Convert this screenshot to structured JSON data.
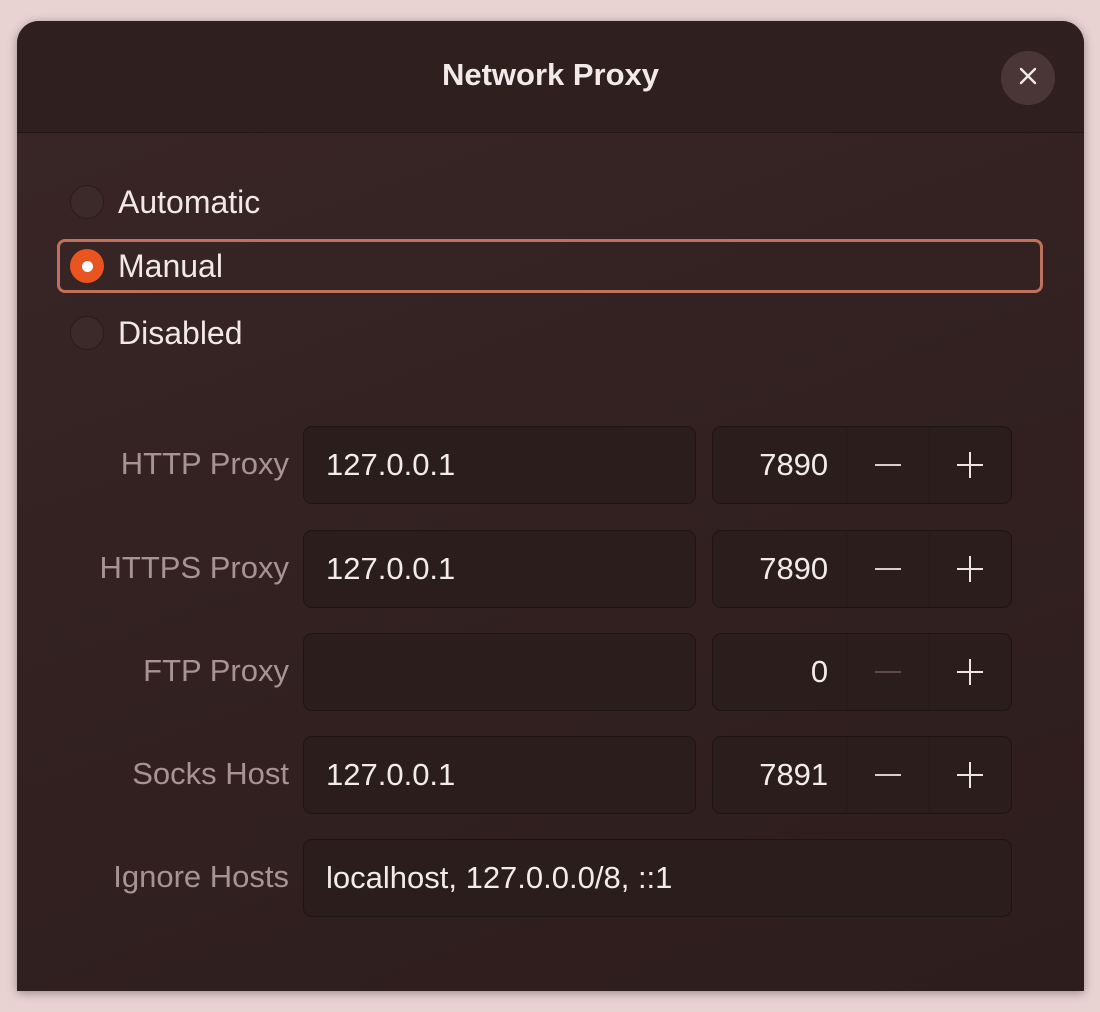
{
  "window": {
    "title": "Network Proxy",
    "close_icon": "close-icon"
  },
  "modes": [
    {
      "label": "Automatic",
      "selected": false
    },
    {
      "label": "Manual",
      "selected": true
    },
    {
      "label": "Disabled",
      "selected": false
    }
  ],
  "proxies": [
    {
      "label": "HTTP Proxy",
      "host": "127.0.0.1",
      "port": "7890",
      "minus_enabled": true
    },
    {
      "label": "HTTPS Proxy",
      "host": "127.0.0.1",
      "port": "7890",
      "minus_enabled": true
    },
    {
      "label": "FTP Proxy",
      "host": "",
      "port": "0",
      "minus_enabled": false
    },
    {
      "label": "Socks Host",
      "host": "127.0.0.1",
      "port": "7891",
      "minus_enabled": true
    }
  ],
  "ignore_hosts": {
    "label": "Ignore Hosts",
    "value": "localhost, 127.0.0.0/8, ::1"
  },
  "colors": {
    "accent": "#e95420",
    "selection_border": "#c0715d",
    "background": "#342222"
  }
}
